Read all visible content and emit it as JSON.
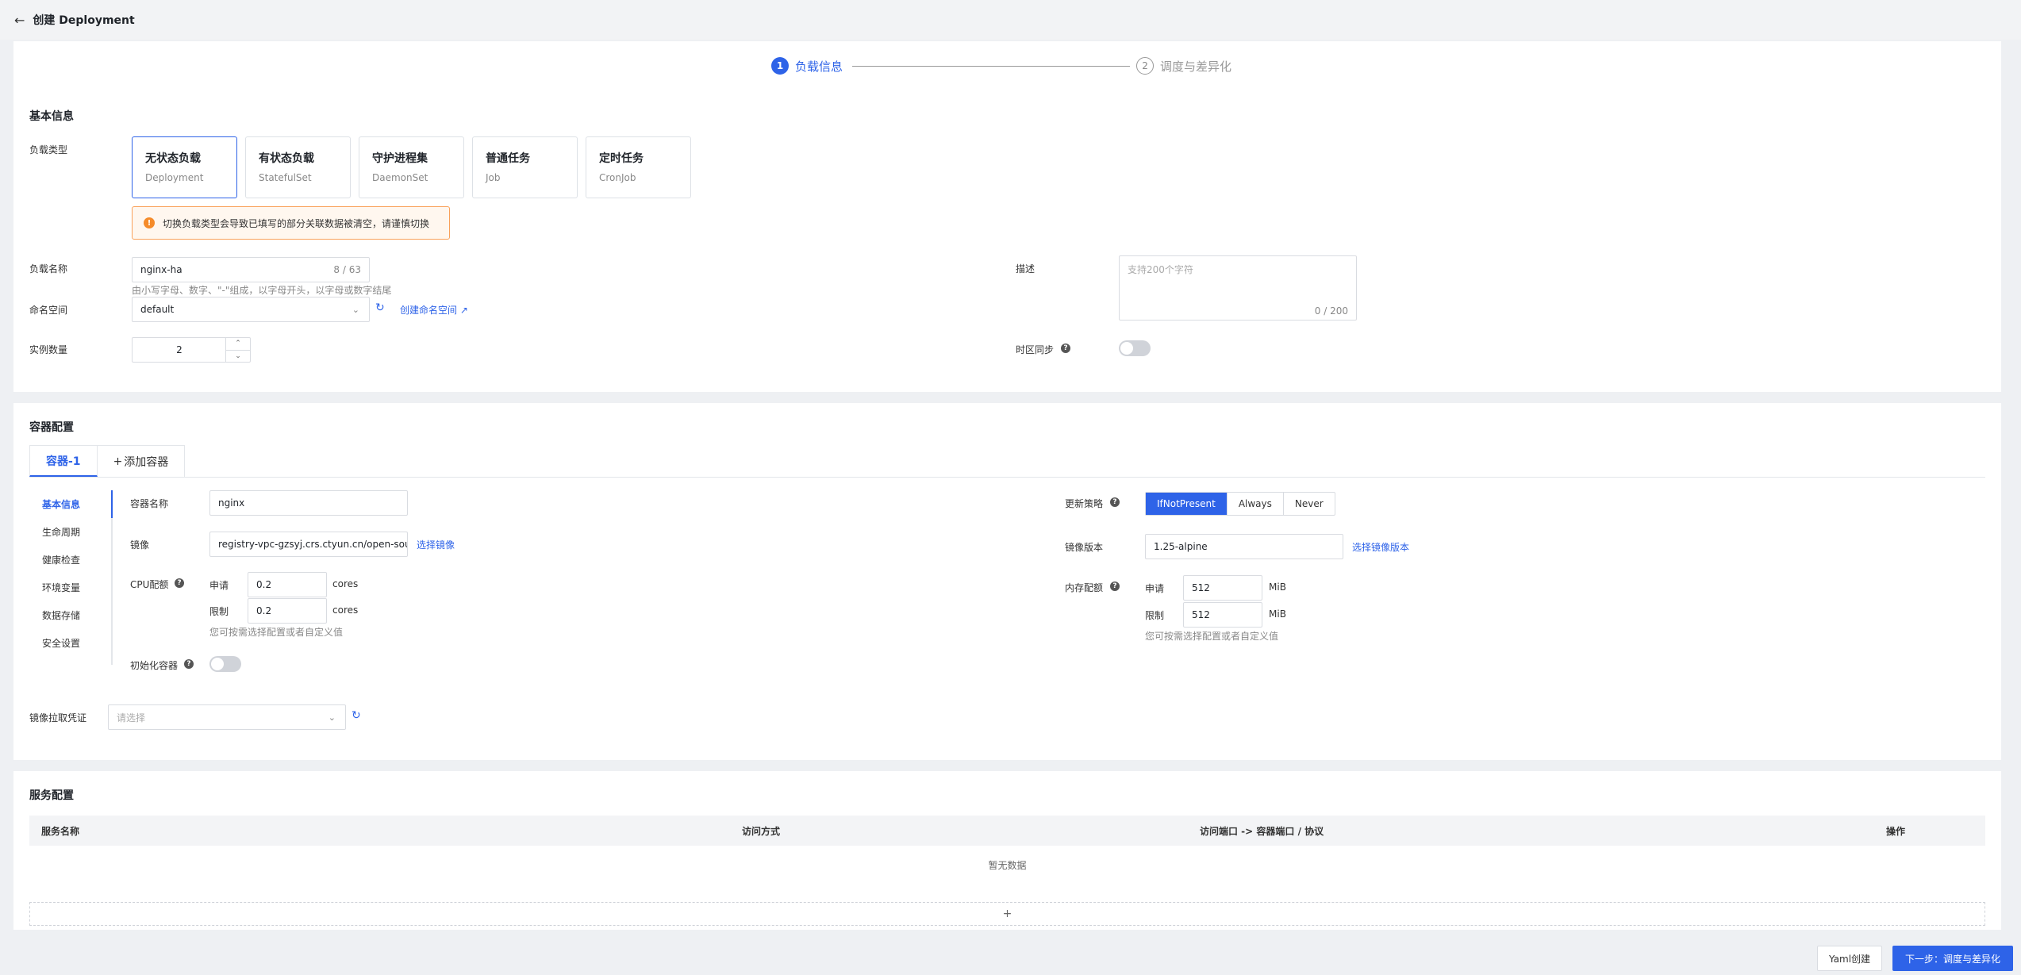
{
  "header": {
    "back_icon": "arrow-left-icon",
    "title": "创建 Deployment"
  },
  "steps": [
    {
      "num": "1",
      "label": "负载信息",
      "state": "active"
    },
    {
      "num": "2",
      "label": "调度与差异化",
      "state": "idle"
    }
  ],
  "basic": {
    "title": "基本信息",
    "type_label": "负载类型",
    "types": [
      {
        "name": "无状态负载",
        "sub": "Deployment",
        "selected": true
      },
      {
        "name": "有状态负载",
        "sub": "StatefulSet",
        "selected": false
      },
      {
        "name": "守护进程集",
        "sub": "DaemonSet",
        "selected": false
      },
      {
        "name": "普通任务",
        "sub": "Job",
        "selected": false
      },
      {
        "name": "定时任务",
        "sub": "CronJob",
        "selected": false
      }
    ],
    "warning": "切换负载类型会导致已填写的部分关联数据被清空，请谨慎切换",
    "name_label": "负载名称",
    "name_value": "nginx-ha",
    "name_counter": "8 / 63",
    "name_hint": "由小写字母、数字、\"-\"组成，以字母开头，以字母或数字结尾",
    "ns_label": "命名空间",
    "ns_value": "default",
    "ns_create_link": "创建命名空间",
    "replicas_label": "实例数量",
    "replicas_value": "2",
    "desc_label": "描述",
    "desc_placeholder": "支持200个字符",
    "desc_counter": "0 / 200",
    "tz_label": "时区同步"
  },
  "container": {
    "title": "容器配置",
    "tabs": [
      "容器-1",
      "添加容器"
    ],
    "nav": [
      "基本信息",
      "生命周期",
      "健康检查",
      "环境变量",
      "数据存储",
      "安全设置"
    ],
    "name_label": "容器名称",
    "name_value": "nginx",
    "image_label": "镜像",
    "image_value": "registry-vpc-gzsyj.crs.ctyun.cn/open-source",
    "image_select_link": "选择镜像",
    "cpu_label": "CPU配额",
    "request_label": "申请",
    "limit_label": "限制",
    "cpu_request": "0.2",
    "cpu_limit": "0.2",
    "cpu_unit": "cores",
    "quota_hint": "您可按需选择配置或者自定义值",
    "init_label": "初始化容器",
    "pull_policy_label": "更新策略",
    "pull_policy_options": [
      "IfNotPresent",
      "Always",
      "Never"
    ],
    "image_version_label": "镜像版本",
    "image_version_value": "1.25-alpine",
    "image_version_link": "选择镜像版本",
    "mem_label": "内存配额",
    "mem_request": "512",
    "mem_limit": "512",
    "mem_unit": "MiB",
    "secret_label": "镜像拉取凭证",
    "secret_placeholder": "请选择"
  },
  "service": {
    "title": "服务配置",
    "columns": [
      "服务名称",
      "访问方式",
      "访问端口 -> 容器端口 / 协议",
      "操作"
    ],
    "empty_text": "暂无数据",
    "add_symbol": "+"
  },
  "footer": {
    "yaml_button": "Yaml创建",
    "next_button": "下一步：调度与差异化"
  },
  "colors": {
    "primary": "#2e63e8",
    "warning_border": "#f9a15a",
    "warning_bg": "#fff7ef"
  }
}
